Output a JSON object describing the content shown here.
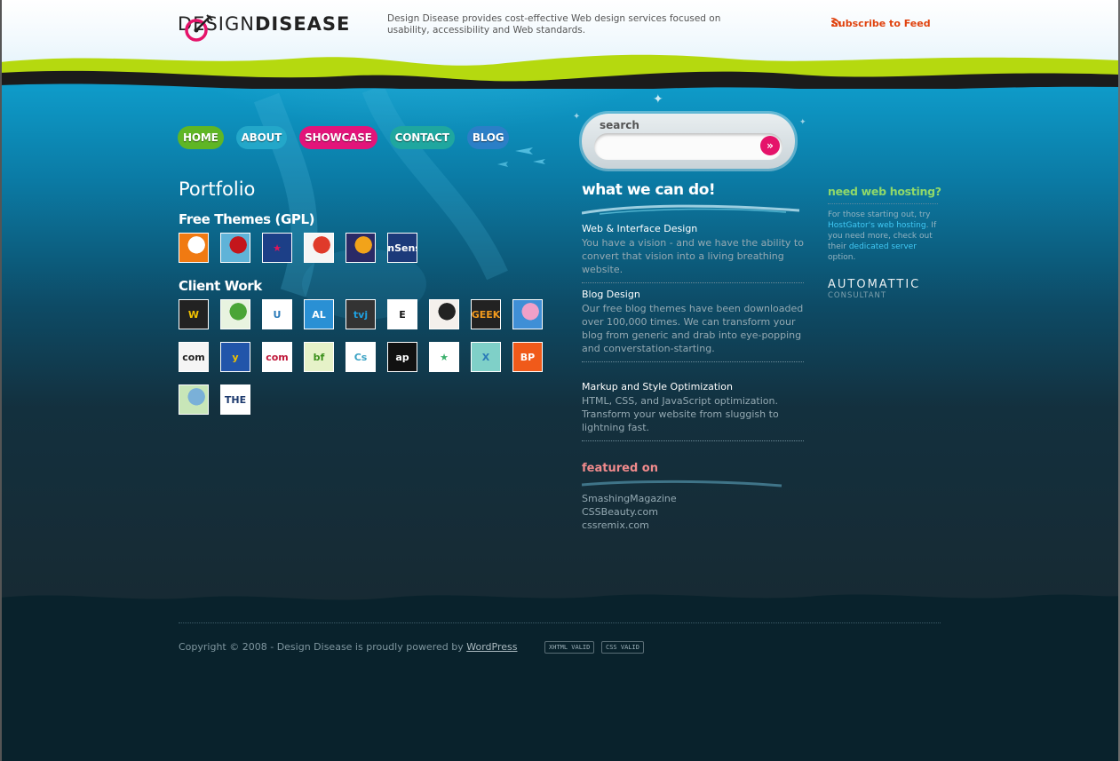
{
  "header": {
    "logo_light": "DESIGN",
    "logo_bold": "DISEASE",
    "tagline": "Design Disease provides cost-effective Web design services focused on usability, accessibility and Web standards.",
    "subscribe": "Subscribe to Feed"
  },
  "nav": {
    "items": [
      {
        "label": "HOME",
        "color": "#5fb625"
      },
      {
        "label": "ABOUT",
        "color": "#23a7c9"
      },
      {
        "label": "SHOWCASE",
        "color": "#e3147a"
      },
      {
        "label": "CONTACT",
        "color": "#1fa79f"
      },
      {
        "label": "BLOG",
        "color": "#2b7fc7"
      }
    ]
  },
  "search": {
    "label": "search",
    "placeholder": "",
    "go_icon": "arrow-right-icon"
  },
  "portfolio": {
    "title": "Portfolio",
    "free_themes_title": "Free Themes (GPL)",
    "client_work_title": "Client Work",
    "free_themes": [
      {
        "name": "theme-orange-swirl",
        "text": "",
        "bg": "#f07a12",
        "fg": "#ffffff"
      },
      {
        "name": "theme-cherries",
        "text": "",
        "bg": "#5fb3d8",
        "fg": "#c4161c"
      },
      {
        "name": "theme-star",
        "text": "★",
        "bg": "#1c3f87",
        "fg": "#e4145a"
      },
      {
        "name": "theme-white-red",
        "text": "",
        "bg": "#f5f5f5",
        "fg": "#e03a2a"
      },
      {
        "name": "theme-colorful-circle",
        "text": "",
        "bg": "#2a2a66",
        "fg": "#f2a31a"
      },
      {
        "name": "theme-insense",
        "text": "InSens",
        "bg": "#1c3a7a",
        "fg": "#ffffff"
      }
    ],
    "client_work": [
      {
        "name": "client-w",
        "text": "W",
        "bg": "#222222",
        "fg": "#f2c200"
      },
      {
        "name": "client-leaf",
        "text": "",
        "bg": "#e8f3e0",
        "fg": "#4aa536"
      },
      {
        "name": "client-blue-green-u",
        "text": "U",
        "bg": "#ffffff",
        "fg": "#2b7bb9"
      },
      {
        "name": "client-al",
        "text": "AL",
        "bg": "#2a90d4",
        "fg": "#ffffff"
      },
      {
        "name": "client-tvj",
        "text": "tvj",
        "bg": "#333333",
        "fg": "#1fa0e0"
      },
      {
        "name": "client-e",
        "text": "E",
        "bg": "#ffffff",
        "fg": "#111111"
      },
      {
        "name": "client-legs",
        "text": "",
        "bg": "#f4f0ec",
        "fg": "#222222"
      },
      {
        "name": "client-geek",
        "text": "GEEK",
        "bg": "#222222",
        "fg": "#f29a1d"
      },
      {
        "name": "client-lily",
        "text": "",
        "bg": "#3f8fd6",
        "fg": "#f0a0c8"
      },
      {
        "name": "client-com-news",
        "text": "com",
        "bg": "#f5f5f5",
        "fg": "#222222"
      },
      {
        "name": "client-arrow-tiles",
        "text": "y",
        "bg": "#2255aa",
        "fg": "#f2c200"
      },
      {
        "name": "client-com-red",
        "text": "com",
        "bg": "#ffffff",
        "fg": "#c0183a"
      },
      {
        "name": "client-bf",
        "text": "bf",
        "bg": "#e6f2c8",
        "fg": "#3a8f1a"
      },
      {
        "name": "client-css",
        "text": "Cs",
        "bg": "#ffffff",
        "fg": "#3aa2c4"
      },
      {
        "name": "client-apple",
        "text": "ap",
        "bg": "#111111",
        "fg": "#ffffff"
      },
      {
        "name": "client-green-star",
        "text": "★",
        "bg": "#ffffff",
        "fg": "#3ab06b"
      },
      {
        "name": "client-x-tiles",
        "text": "X",
        "bg": "#7fd0c8",
        "fg": "#2a7ab8"
      },
      {
        "name": "client-bp",
        "text": "BP",
        "bg": "#f05a1a",
        "fg": "#ffffff"
      },
      {
        "name": "client-green-squares",
        "text": "",
        "bg": "#c8e6b8",
        "fg": "#7ab0d8"
      },
      {
        "name": "client-the",
        "text": "THE",
        "bg": "#ffffff",
        "fg": "#1d3a6e"
      }
    ]
  },
  "services": {
    "title": "what we can do!",
    "items": [
      {
        "title": "Web & Interface Design",
        "desc": "You have a vision - and we have the ability to convert that vision into a living breathing website."
      },
      {
        "title": "Blog Design",
        "desc": "Our free blog themes have been downloaded over 100,000 times. We can transform your blog from generic and drab into eye-popping and converstation-starting."
      },
      {
        "title": "Markup and Style Optimization",
        "desc": "HTML, CSS, and JavaScript optimization. Transform your website from sluggish to lightning fast."
      }
    ]
  },
  "featured": {
    "title": "featured on",
    "items": [
      "SmashingMagazine",
      "CSSBeauty.com",
      "cssremix.com"
    ]
  },
  "hosting": {
    "title": "need web hosting?",
    "text_1": "For those starting out, try ",
    "link_1": "HostGator's web hosting",
    "text_2": ". If you need more, check out their ",
    "link_2": "dedicated server",
    "text_3": " option.",
    "automattic": "AUTOMATTIC",
    "consultant": "CONSULTANT"
  },
  "footer": {
    "copyright": "Copyright © 2008 - Design Disease is proudly powered by ",
    "wordpress": "WordPress",
    "xhtml_badge": "XHTML VALID",
    "css_badge": "CSS VALID"
  },
  "colors": {
    "accent_pink": "#e5136a",
    "green": "#8fd86a",
    "feed_orange": "#e0420e"
  }
}
